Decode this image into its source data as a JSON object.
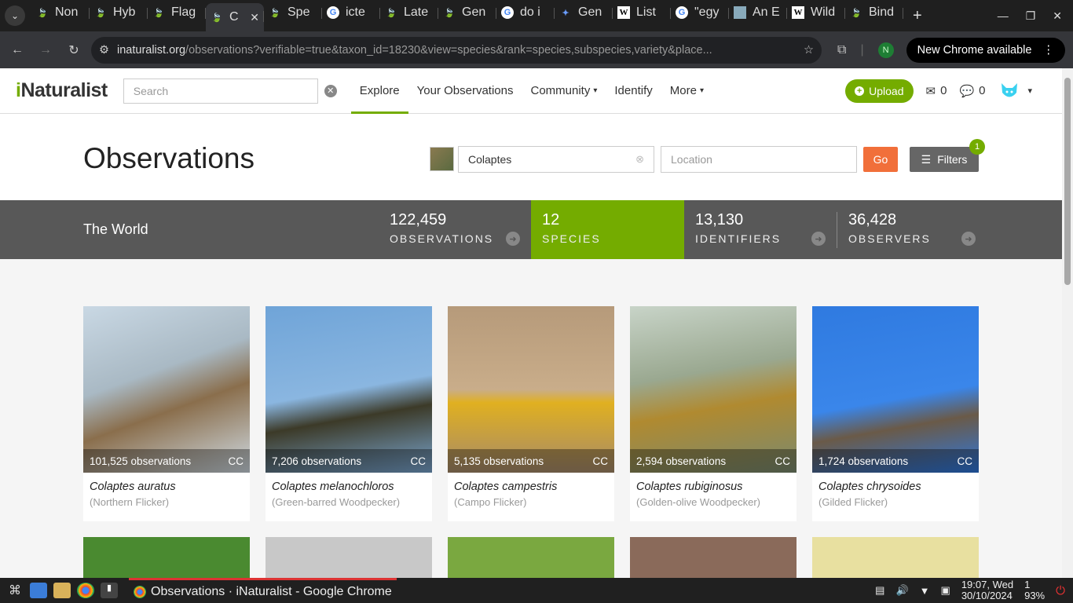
{
  "browser": {
    "tabs": [
      {
        "label": "Non",
        "icon": "leaf"
      },
      {
        "label": "Hyb",
        "icon": "leaf"
      },
      {
        "label": "Flag",
        "icon": "leaf"
      },
      {
        "label": "C",
        "icon": "leaf",
        "active": true
      },
      {
        "label": "Spe",
        "icon": "leaf"
      },
      {
        "label": "icte",
        "icon": "google"
      },
      {
        "label": "Late",
        "icon": "inat"
      },
      {
        "label": "Gen",
        "icon": "leaf"
      },
      {
        "label": "do i",
        "icon": "google"
      },
      {
        "label": "Gen",
        "icon": "gemini"
      },
      {
        "label": "List",
        "icon": "wikipedia"
      },
      {
        "label": "\"egy",
        "icon": "google"
      },
      {
        "label": "An E",
        "icon": "image"
      },
      {
        "label": "Wild",
        "icon": "wikipedia"
      },
      {
        "label": "Bind",
        "icon": "inat"
      }
    ],
    "url_host": "inaturalist.org",
    "url_rest": "/observations?verifiable=true&taxon_id=18230&view=species&rank=species,subspecies,variety&place...",
    "profile_initial": "N",
    "update_label": "New Chrome available"
  },
  "header": {
    "logo_prefix": "i",
    "logo_rest": "Naturalist",
    "search_placeholder": "Search",
    "nav": [
      "Explore",
      "Your Observations",
      "Community",
      "Identify",
      "More"
    ],
    "upload_label": "Upload",
    "messages_count": "0",
    "comments_count": "0"
  },
  "obs": {
    "title": "Observations",
    "taxon_value": "Colaptes",
    "location_placeholder": "Location",
    "go_label": "Go",
    "filters_label": "Filters",
    "filters_badge": "1"
  },
  "stats": {
    "place": "The World",
    "observations_num": "122,459",
    "observations_lbl": "OBSERVATIONS",
    "species_num": "12",
    "species_lbl": "SPECIES",
    "identifiers_num": "13,130",
    "identifiers_lbl": "IDENTIFIERS",
    "observers_num": "36,428",
    "observers_lbl": "OBSERVERS"
  },
  "species": [
    {
      "obs": "101,525 observations",
      "license": "CC",
      "sci": "Colaptes auratus",
      "common": "(Northern Flicker)"
    },
    {
      "obs": "7,206 observations",
      "license": "CC",
      "sci": "Colaptes melanochloros",
      "common": "(Green-barred Woodpecker)"
    },
    {
      "obs": "5,135 observations",
      "license": "CC",
      "sci": "Colaptes campestris",
      "common": "(Campo Flicker)"
    },
    {
      "obs": "2,594 observations",
      "license": "CC",
      "sci": "Colaptes rubiginosus",
      "common": "(Golden-olive Woodpecker)"
    },
    {
      "obs": "1,724 observations",
      "license": "CC",
      "sci": "Colaptes chrysoides",
      "common": "(Gilded Flicker)"
    }
  ],
  "taskbar": {
    "app_title": "Observations · iNaturalist - Google Chrome",
    "time": "19:07, Wed",
    "date": "30/10/2024",
    "workspace": "1",
    "battery": "93%"
  }
}
